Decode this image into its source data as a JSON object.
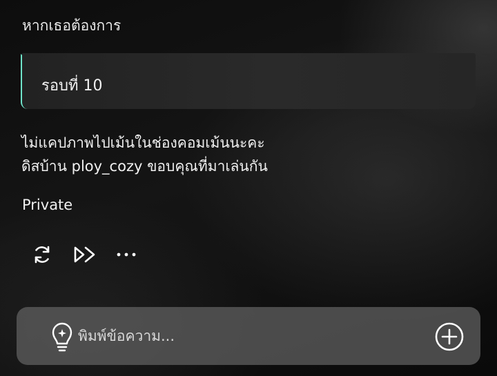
{
  "intro": {
    "text": "หากเธอต้องการ"
  },
  "card": {
    "text": "รอบที่ 10"
  },
  "message": {
    "line1": "ไม่แคปภาพไปเม้นในช่องคอมเม้นนะคะ",
    "line2": "ดิสบ้าน ploy_cozy ขอบคุณที่มาเล่นกัน"
  },
  "privacy": {
    "label": "Private"
  },
  "actions": [
    {
      "icon": "refresh-icon"
    },
    {
      "icon": "fast-forward-icon"
    },
    {
      "icon": "more-icon"
    }
  ],
  "composer": {
    "placeholder": "พิมพ์ข้อความ...",
    "value": "",
    "left_icon": "lightbulb-icon",
    "right_icon": "plus-circle-icon"
  },
  "colors": {
    "background": "#0d0d0d",
    "card": "#262626",
    "accent_gradient": [
      "#e6c35a",
      "#8fd86a",
      "#4fd9d2"
    ],
    "composer": "#5c5c5c",
    "text": "#ffffff"
  }
}
